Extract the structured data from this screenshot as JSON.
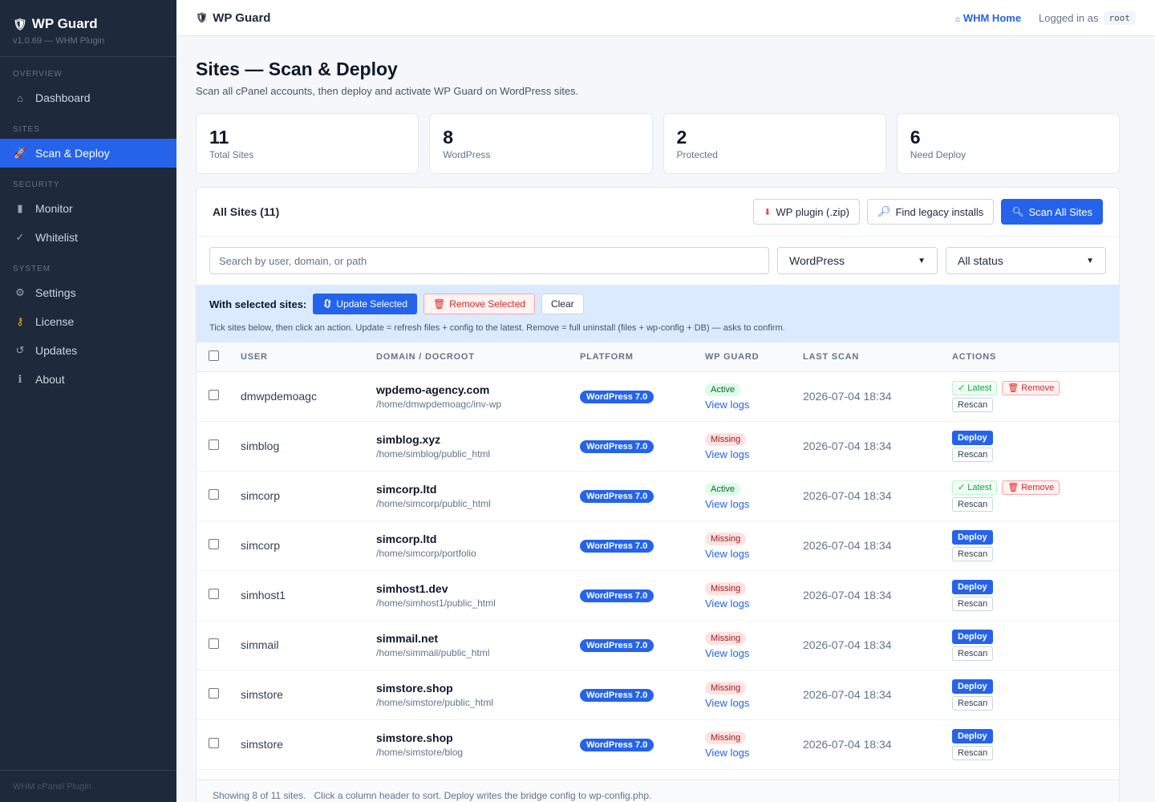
{
  "app": {
    "name": "WP Guard",
    "version": "v1.0.69 — WHM Plugin",
    "footer": "WHM cPanel Plugin"
  },
  "sidebar": {
    "sections": [
      {
        "label": "OVERVIEW",
        "items": [
          {
            "label": "Dashboard",
            "icon": "house-icon"
          }
        ]
      },
      {
        "label": "SITES",
        "items": [
          {
            "label": "Scan & Deploy",
            "icon": "rocket-icon",
            "active": true
          }
        ]
      },
      {
        "label": "SECURITY",
        "items": [
          {
            "label": "Monitor",
            "icon": "chart-icon"
          },
          {
            "label": "Whitelist",
            "icon": "check-icon"
          }
        ]
      },
      {
        "label": "SYSTEM",
        "items": [
          {
            "label": "Settings",
            "icon": "gear-icon"
          },
          {
            "label": "License",
            "icon": "key-icon"
          },
          {
            "label": "Updates",
            "icon": "refresh-icon"
          },
          {
            "label": "About",
            "icon": "info-icon"
          }
        ]
      }
    ]
  },
  "topbar": {
    "title": "WP Guard",
    "whm_home": "WHM Home",
    "logged_in_as": "Logged in as",
    "user": "root"
  },
  "page": {
    "title": "Sites — Scan & Deploy",
    "subtitle": "Scan all cPanel accounts, then deploy and activate WP Guard on WordPress sites."
  },
  "stats": [
    {
      "value": "11",
      "label": "Total Sites"
    },
    {
      "value": "8",
      "label": "WordPress"
    },
    {
      "value": "2",
      "label": "Protected"
    },
    {
      "value": "6",
      "label": "Need Deploy"
    }
  ],
  "panel": {
    "title": "All Sites (11)",
    "buttons": {
      "plugin_zip": "WP plugin (.zip)",
      "find_legacy": "Find legacy installs",
      "scan_all": "Scan All Sites"
    },
    "search_placeholder": "Search by user, domain, or path",
    "platform_filter": "WordPress",
    "status_filter": "All status",
    "bulk": {
      "label": "With selected sites:",
      "update": "Update Selected",
      "remove": "Remove Selected",
      "clear": "Clear",
      "hint": "Tick sites below, then click an action. Update = refresh files + config to the latest. Remove = full uninstall (files + wp-config + DB) — asks to confirm."
    },
    "columns": [
      "USER",
      "DOMAIN / DOCROOT",
      "PLATFORM",
      "WP GUARD",
      "LAST SCAN",
      "ACTIONS"
    ],
    "view_logs": "View logs",
    "action_labels": {
      "latest": "✓ Latest",
      "remove": "Remove",
      "rescan": "Rescan",
      "deploy": "Deploy"
    },
    "rows": [
      {
        "user": "dmwpdemoagc",
        "domain": "wpdemo-agency.com",
        "path": "/home/dmwpdemoagc/inv-wp",
        "platform": "WordPress 7.0",
        "guard": "Active",
        "last_scan": "2026-07-04 18:34"
      },
      {
        "user": "simblog",
        "domain": "simblog.xyz",
        "path": "/home/simblog/public_html",
        "platform": "WordPress 7.0",
        "guard": "Missing",
        "last_scan": "2026-07-04 18:34"
      },
      {
        "user": "simcorp",
        "domain": "simcorp.ltd",
        "path": "/home/simcorp/public_html",
        "platform": "WordPress 7.0",
        "guard": "Active",
        "last_scan": "2026-07-04 18:34"
      },
      {
        "user": "simcorp",
        "domain": "simcorp.ltd",
        "path": "/home/simcorp/portfolio",
        "platform": "WordPress 7.0",
        "guard": "Missing",
        "last_scan": "2026-07-04 18:34"
      },
      {
        "user": "simhost1",
        "domain": "simhost1.dev",
        "path": "/home/simhost1/public_html",
        "platform": "WordPress 7.0",
        "guard": "Missing",
        "last_scan": "2026-07-04 18:34"
      },
      {
        "user": "simmail",
        "domain": "simmail.net",
        "path": "/home/simmail/public_html",
        "platform": "WordPress 7.0",
        "guard": "Missing",
        "last_scan": "2026-07-04 18:34"
      },
      {
        "user": "simstore",
        "domain": "simstore.shop",
        "path": "/home/simstore/public_html",
        "platform": "WordPress 7.0",
        "guard": "Missing",
        "last_scan": "2026-07-04 18:34"
      },
      {
        "user": "simstore",
        "domain": "simstore.shop",
        "path": "/home/simstore/blog",
        "platform": "WordPress 7.0",
        "guard": "Missing",
        "last_scan": "2026-07-04 18:34"
      }
    ],
    "footer": "Showing 8 of 11 sites.   Click a column header to sort. Deploy writes the bridge config to wp-config.php."
  }
}
